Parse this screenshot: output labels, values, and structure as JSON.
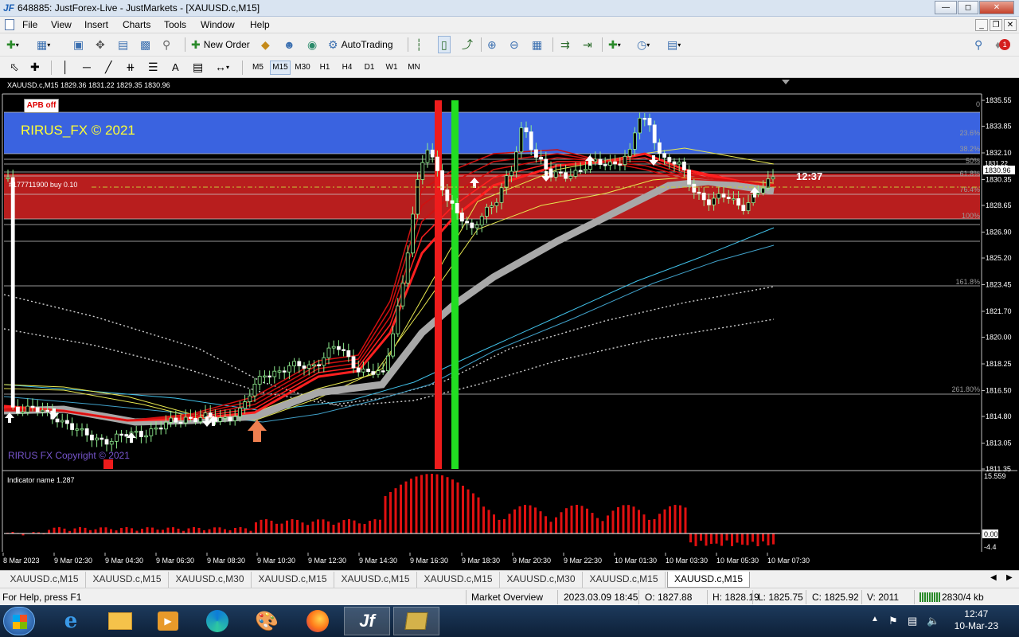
{
  "window": {
    "logo": "JF",
    "title": "648885: JustForex-Live - JustMarkets - [XAUUSD.c,M15]"
  },
  "menu": [
    "File",
    "View",
    "Insert",
    "Charts",
    "Tools",
    "Window",
    "Help"
  ],
  "toolbar": {
    "new_order": "New Order",
    "autotrading": "AutoTrading",
    "notif_count": "1"
  },
  "timeframes": [
    "M5",
    "M15",
    "M30",
    "H1",
    "H4",
    "D1",
    "W1",
    "MN"
  ],
  "selected_timeframe": "M15",
  "chart": {
    "header": "XAUUSD.c,M15  1829.36 1831.22 1829.35 1830.96",
    "apb_button": "APB off",
    "watermark_top": "RIRUS_FX © 2021",
    "watermark_bottom": "RIRUS FX Copyright © 2021",
    "order_label": "#177711900 buy 0.10",
    "countdown": "12:37",
    "current_price": "1830.96",
    "ask_price": "1831.22",
    "price_axis": [
      "1835.55",
      "1833.85",
      "1832.10",
      "1830.35",
      "1828.65",
      "1826.90",
      "1825.20",
      "1823.45",
      "1821.70",
      "1820.00",
      "1818.25",
      "1816.50",
      "1814.80",
      "1813.05",
      "1811.35"
    ],
    "fib_labels": [
      "0",
      "23.6%",
      "38.2%",
      "50%",
      "61.8%",
      "76.4%",
      "100%",
      "161.8%",
      "261.80%"
    ],
    "indicator_label": "Indicator name 1.287",
    "indicator_axis": [
      "15.559",
      "0.00",
      "-4.4"
    ],
    "time_axis": [
      "8 Mar 2023",
      "9 Mar 02:30",
      "9 Mar 04:30",
      "9 Mar 06:30",
      "9 Mar 08:30",
      "9 Mar 10:30",
      "9 Mar 12:30",
      "9 Mar 14:30",
      "9 Mar 16:30",
      "9 Mar 18:30",
      "9 Mar 20:30",
      "9 Mar 22:30",
      "10 Mar 01:30",
      "10 Mar 03:30",
      "10 Mar 05:30",
      "10 Mar 07:30"
    ],
    "colors": {
      "blue_zone": "#3a63e0",
      "red_zone": "#b81e1e",
      "bull_candle": "#90ee90",
      "bear_candle": "#ffffff",
      "histogram": "#e01010"
    }
  },
  "tabs": [
    "XAUUSD.c,M15",
    "XAUUSD.c,M15",
    "XAUUSD.c,M30",
    "XAUUSD.c,M15",
    "XAUUSD.c,M15",
    "XAUUSD.c,M15",
    "XAUUSD.c,M30",
    "XAUUSD.c,M15",
    "XAUUSD.c,M15"
  ],
  "active_tab": 8,
  "status": {
    "help": "For Help, press F1",
    "profile": "Market Overview",
    "datetime": "2023.03.09 18:45",
    "open": "O: 1827.88",
    "high": "H: 1828.19",
    "low": "L: 1825.75",
    "close": "C: 1825.92",
    "volume": "V: 2011",
    "traffic": "2830/4 kb"
  },
  "taskbar": {
    "time": "12:47",
    "date": "10-Mar-23"
  }
}
